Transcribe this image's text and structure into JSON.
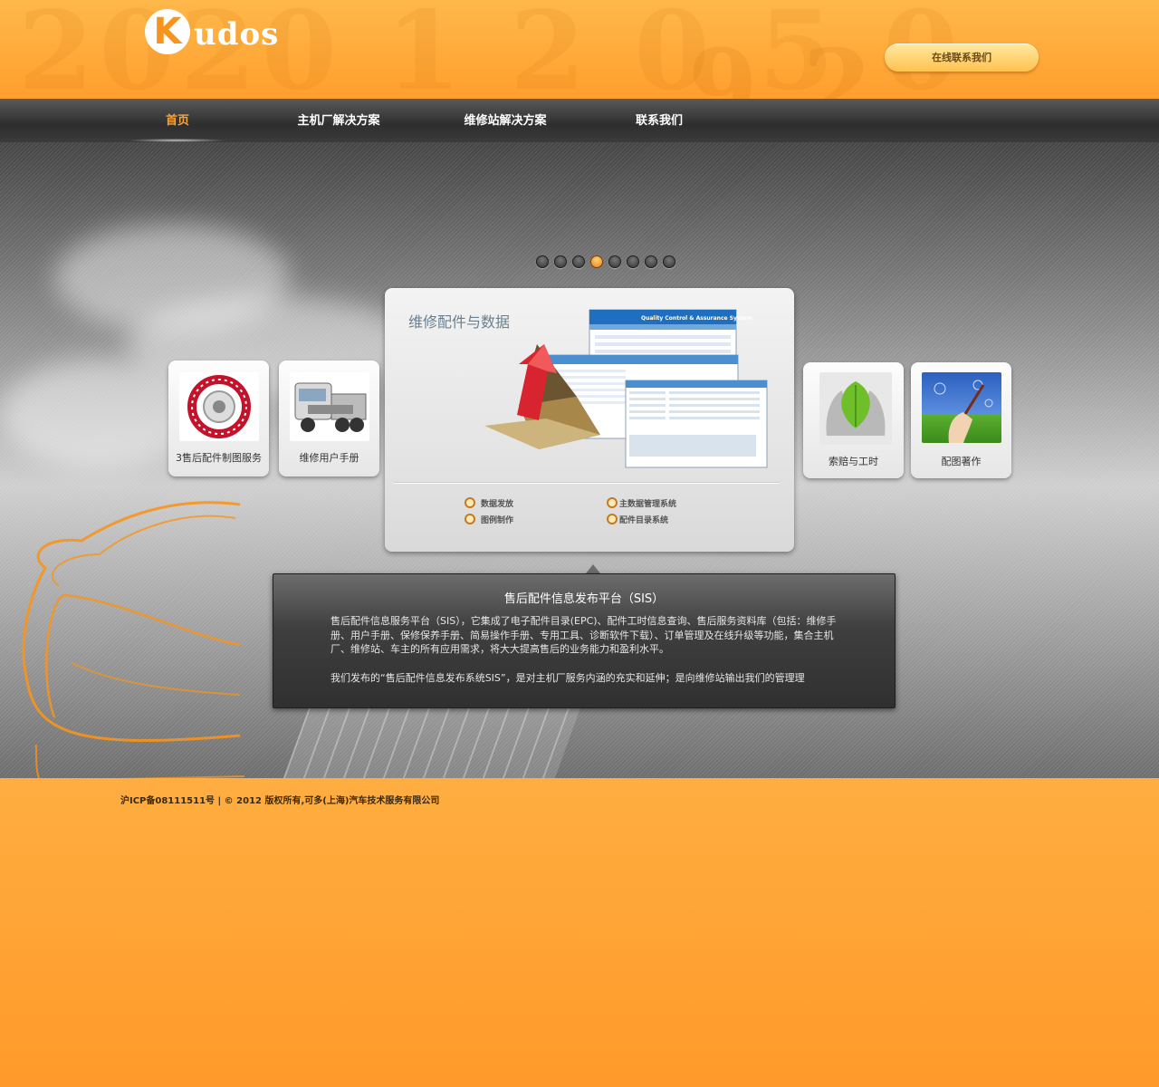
{
  "header": {
    "logo_letter": "K",
    "logo_text": "udos",
    "deco_text_1": "2020 1 2 0 5 0",
    "deco_text_2": "9 2",
    "contact_button": "在线联系我们"
  },
  "nav": {
    "items": [
      {
        "label": "首页",
        "active": true
      },
      {
        "label": "主机厂解决方案",
        "active": false
      },
      {
        "label": "维修站解决方案",
        "active": false
      },
      {
        "label": "联系我们",
        "active": false
      }
    ]
  },
  "slider": {
    "dot_count": 8,
    "active_dot": 4
  },
  "cards": {
    "left": [
      {
        "label": "3售后配件制图服务",
        "icon": "gear-parts-image"
      },
      {
        "label": "维修用户手册",
        "icon": "truck-cutaway-image"
      }
    ],
    "right": [
      {
        "label": "索赔与工时",
        "icon": "hands-leaf-image"
      },
      {
        "label": "配图著作",
        "icon": "hand-pen-image"
      }
    ]
  },
  "panel": {
    "title": "维修配件与数据",
    "links": [
      "数据发放",
      "主数据管理系统",
      "图例制作",
      "配件目录系统"
    ],
    "screenshot_caption": "Quality Control & Assurance System"
  },
  "tooltip": {
    "title": "售后配件信息发布平台（SIS）",
    "paragraph_1": "售后配件信息服务平台（SIS），它集成了电子配件目录(EPC)、配件工时信息查询、售后服务资料库（包括：维修手册、用户手册、保修保养手册、简易操作手册、专用工具、诊断软件下载）、订单管理及在线升级等功能，集合主机厂、维修站、车主的所有应用需求，将大大提高售后的业务能力和盈利水平。",
    "paragraph_2": "我们发布的“售后配件信息发布系统SIS”，是对主机厂服务内涵的充实和延伸；是向维修站输出我们的管理理"
  },
  "footer": {
    "text": "沪ICP备08111511号 | © 2012 版权所有,可多(上海)汽车技术服务有限公司"
  },
  "colors": {
    "accent": "#f7941d",
    "nav_active": "#f7a53a",
    "nav_bg": "#2e2e2e"
  }
}
